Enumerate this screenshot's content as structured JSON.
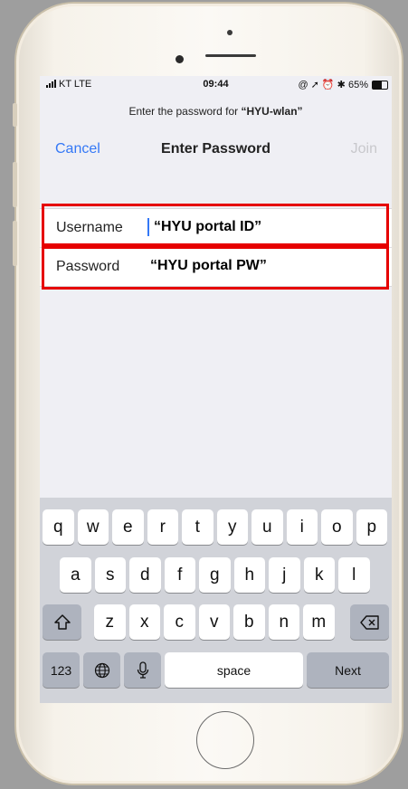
{
  "status_bar": {
    "carrier": "KT LTE",
    "time": "09:44",
    "battery": "65%",
    "battery_level": 0.65
  },
  "prompt": {
    "text": "Enter the password for ",
    "network": "“HYU-wlan”"
  },
  "navbar": {
    "cancel_label": "Cancel",
    "title": "Enter Password",
    "join_label": "Join"
  },
  "form": {
    "username_label": "Username",
    "username_value": "“HYU portal ID”",
    "password_label": "Password",
    "password_value": "“HYU portal PW”"
  },
  "keyboard": {
    "row1": [
      "q",
      "w",
      "e",
      "r",
      "t",
      "y",
      "u",
      "i",
      "o",
      "p"
    ],
    "row2": [
      "a",
      "s",
      "d",
      "f",
      "g",
      "h",
      "j",
      "k",
      "l"
    ],
    "row3": [
      "z",
      "x",
      "c",
      "v",
      "b",
      "n",
      "m"
    ],
    "numbers_label": "123",
    "space_label": "space",
    "next_label": "Next"
  },
  "colors": {
    "accent": "#3478f6",
    "highlight": "#e60000",
    "disabled": "#c8c8cc"
  }
}
